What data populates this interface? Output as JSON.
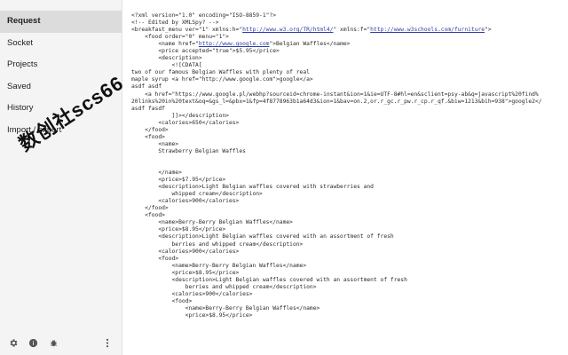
{
  "sidebar": {
    "items": [
      {
        "label": "Request",
        "active": true
      },
      {
        "label": "Socket"
      },
      {
        "label": "Projects"
      },
      {
        "label": "Saved"
      },
      {
        "label": "History"
      },
      {
        "label": "Import / export"
      }
    ],
    "footer_icons": [
      "gear-icon",
      "info-icon",
      "bug-icon",
      "more-vert-icon"
    ],
    "watermark": "数创社scs66"
  },
  "editor": {
    "lines": [
      {
        "t": "<?xml version=\"1.0\" encoding=\"ISO-8859-1\"?>"
      },
      {
        "t": "<!-- Edited by XMLSpy? -->"
      },
      {
        "t": "<breakfast_menu ver=\"1\" xmlns:h=\"",
        "link1": "http://www.w3.org/TR/html4/",
        "mid": "\" xmlns:f=\"",
        "link2": "http://www.w3schools.com/furniture",
        "end": "\">"
      },
      {
        "t": "    <food order=\"0\" menu=\"1\">"
      },
      {
        "t": "        <name href=\"",
        "link1": "http://www.google.com",
        "end": "\">Belgian Waffles</name>"
      },
      {
        "t": "        <price accepted=\"true\">$5.95</price>"
      },
      {
        "t": "        <description>"
      },
      {
        "t": "            <![CDATA["
      },
      {
        "t": "two of our famous Belgian Waffles with plenty of real"
      },
      {
        "t": "maple syrup <a href=\"http://www.google.com\">google</a>"
      },
      {
        "t": "asdf asdf"
      },
      {
        "t": "    <a href=\"https://www.google.pl/webhp?sourceid=chrome-instant&ion=1&ie=UTF-8#hl=en&sclient=psy-ab&q=javascript%20find%"
      },
      {
        "t": "20links%20in%20text&oq=&gs_l=&pbx=1&fp=4f8778963b1a64d3&ion=1&bav=on.2,or.r_gc.r_pw.r_cp.r_qf.&biw=1213&bih=938\">google2</"
      },
      {
        "t": "asdf fasdf"
      },
      {
        "t": "            ]]></description>"
      },
      {
        "t": "        <calories>650</calories>"
      },
      {
        "t": "    </food>"
      },
      {
        "t": "    <food>"
      },
      {
        "t": "        <name>"
      },
      {
        "t": "        Strawberry Belgian Waffles"
      },
      {
        "t": ""
      },
      {
        "t": ""
      },
      {
        "t": "        </name>"
      },
      {
        "t": "        <price>$7.95</price>"
      },
      {
        "t": "        <description>Light Belgian waffles covered with strawberries and"
      },
      {
        "t": "            whipped cream</description>"
      },
      {
        "t": "        <calories>900</calories>"
      },
      {
        "t": "    </food>"
      },
      {
        "t": "    <food>"
      },
      {
        "t": "        <name>Berry-Berry Belgian Waffles</name>"
      },
      {
        "t": "        <price>$8.95</price>"
      },
      {
        "t": "        <description>Light Belgian waffles covered with an assortment of fresh"
      },
      {
        "t": "            berries and whipped cream</description>"
      },
      {
        "t": "        <calories>900</calories>"
      },
      {
        "t": "        <food>"
      },
      {
        "t": "            <name>Berry-Berry Belgian Waffles</name>"
      },
      {
        "t": "            <price>$8.95</price>"
      },
      {
        "t": "            <description>Light Belgian waffles covered with an assortment of fresh"
      },
      {
        "t": "                berries and whipped cream</description>"
      },
      {
        "t": "            <calories>900</calories>"
      },
      {
        "t": "            <food>"
      },
      {
        "t": "                <name>Berry-Berry Belgian Waffles</name>"
      },
      {
        "t": "                <price>$8.95</price>"
      }
    ]
  },
  "colors": {
    "link": "#2b3ea8",
    "sidebar_bg": "#f4f4f4",
    "active_bg": "#dcdcdc"
  }
}
